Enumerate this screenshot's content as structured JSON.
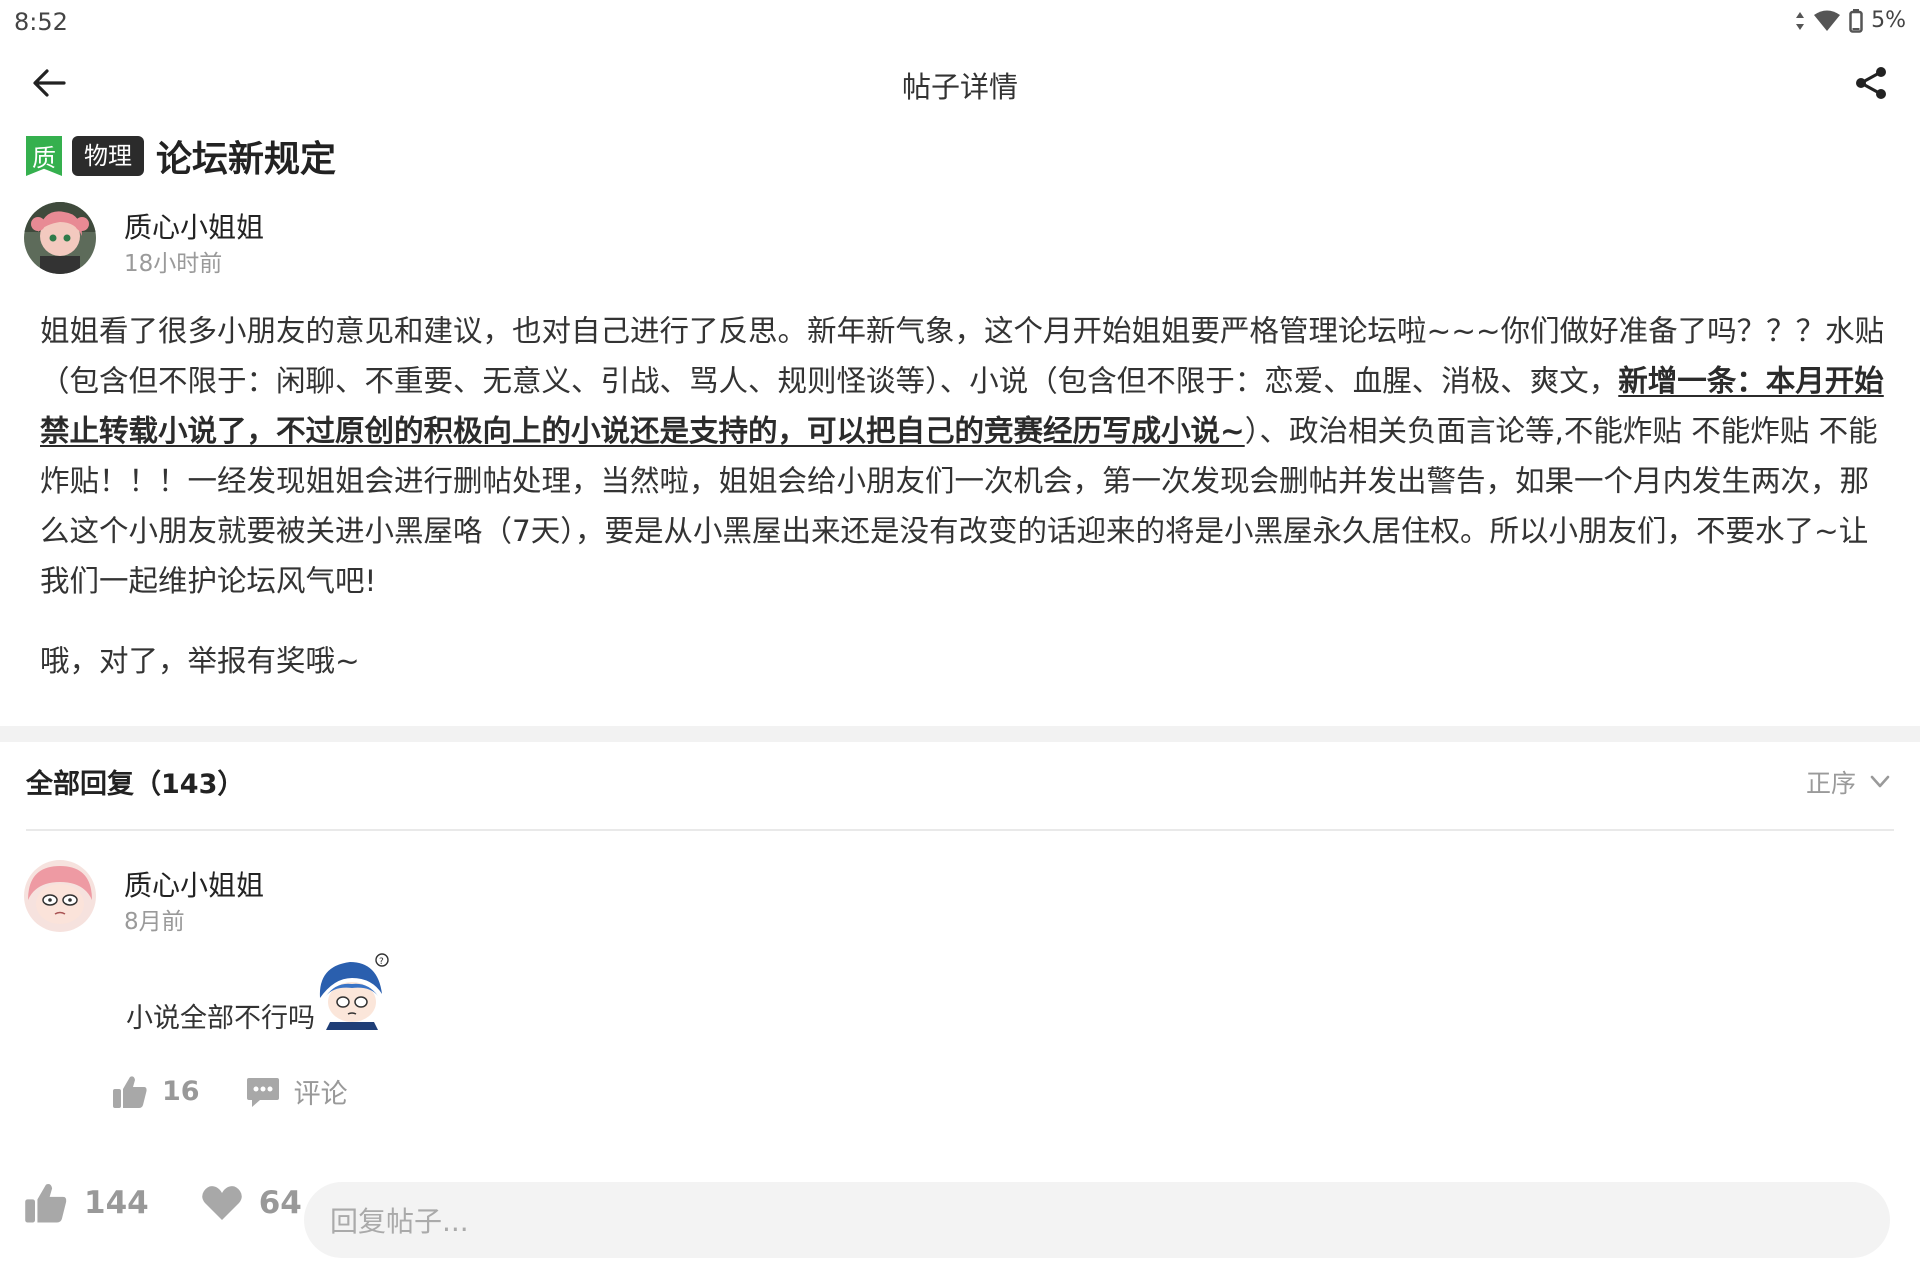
{
  "status_bar": {
    "time": "8:52",
    "battery": "5%"
  },
  "header": {
    "title": "帖子详情"
  },
  "post": {
    "badge_quality": "质",
    "badge_subject": "物理",
    "title": "论坛新规定",
    "author": {
      "name": "质心小姐姐",
      "time": "18小时前"
    },
    "body_part1": "姐姐看了很多小朋友的意见和建议，也对自己进行了反思。新年新气象，这个月开始姐姐要严格管理论坛啦~~~你们做好准备了吗？？？水贴（包含但不限于：闲聊、不重要、无意义、引战、骂人、规则怪谈等）、小说（包含但不限于：恋爱、血腥、消极、爽文，",
    "body_highlight": "新增一条：本月开始禁止转载小说了，不过原创的积极向上的小说还是支持的，可以把自己的竞赛经历写成小说~",
    "body_part2": "）、政治相关负面言论等,不能炸贴 不能炸贴 不能炸贴！！！一经发现姐姐会进行删帖处理，当然啦，姐姐会给小朋友们一次机会，第一次发现会删帖并发出警告，如果一个月内发生两次，那么这个小朋友就要被关进小黑屋咯（7天），要是从小黑屋出来还是没有改变的话迎来的将是小黑屋永久居住权。所以小朋友们，不要水了~让我们一起维护论坛风气吧!",
    "note": "哦，对了，举报有奖哦~"
  },
  "replies": {
    "heading": "全部回复（143）",
    "sort_label": "正序",
    "items": [
      {
        "author": "质心小姐姐",
        "time": "8月前",
        "text": "小说全部不行吗",
        "likes": "16",
        "comment_label": "评论"
      }
    ]
  },
  "bottom_bar": {
    "likes": "144",
    "favorites": "64",
    "reply_placeholder": "回复帖子..."
  },
  "colors": {
    "quality_badge": "#35b04e",
    "subject_badge": "#2b2b2b",
    "muted_text": "#9a9a9a",
    "input_bg": "#f3f3f3"
  }
}
